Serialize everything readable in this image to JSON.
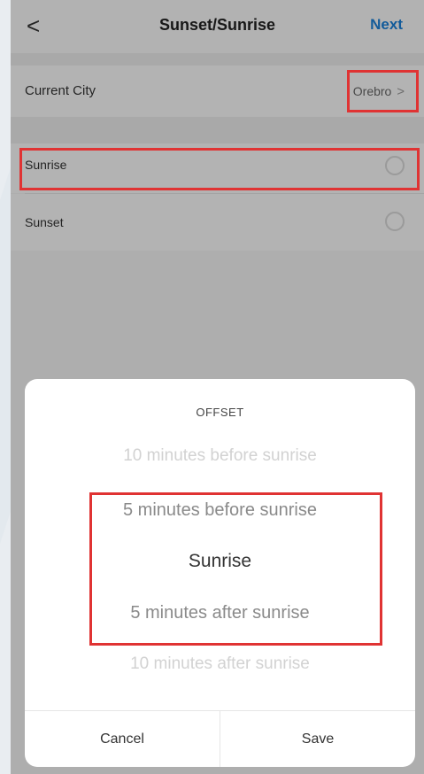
{
  "header": {
    "back_glyph": "<",
    "title": "Sunset/Sunrise",
    "next_label": "Next"
  },
  "city": {
    "label": "Current City",
    "value": "Orebro",
    "chevron": ">"
  },
  "options": [
    {
      "label": "Sunrise"
    },
    {
      "label": "Sunset"
    }
  ],
  "picker": {
    "title": "OFFSET",
    "items": [
      "10 minutes before sunrise",
      "5 minutes before sunrise",
      "Sunrise",
      "5 minutes after sunrise",
      "10 minutes after sunrise"
    ],
    "selected": "Sunrise",
    "cancel_label": "Cancel",
    "save_label": "Save"
  },
  "colors": {
    "accent": "#1a7fd6",
    "highlight": "#e03333",
    "overlay": "rgba(0,0,0,0.28)"
  }
}
